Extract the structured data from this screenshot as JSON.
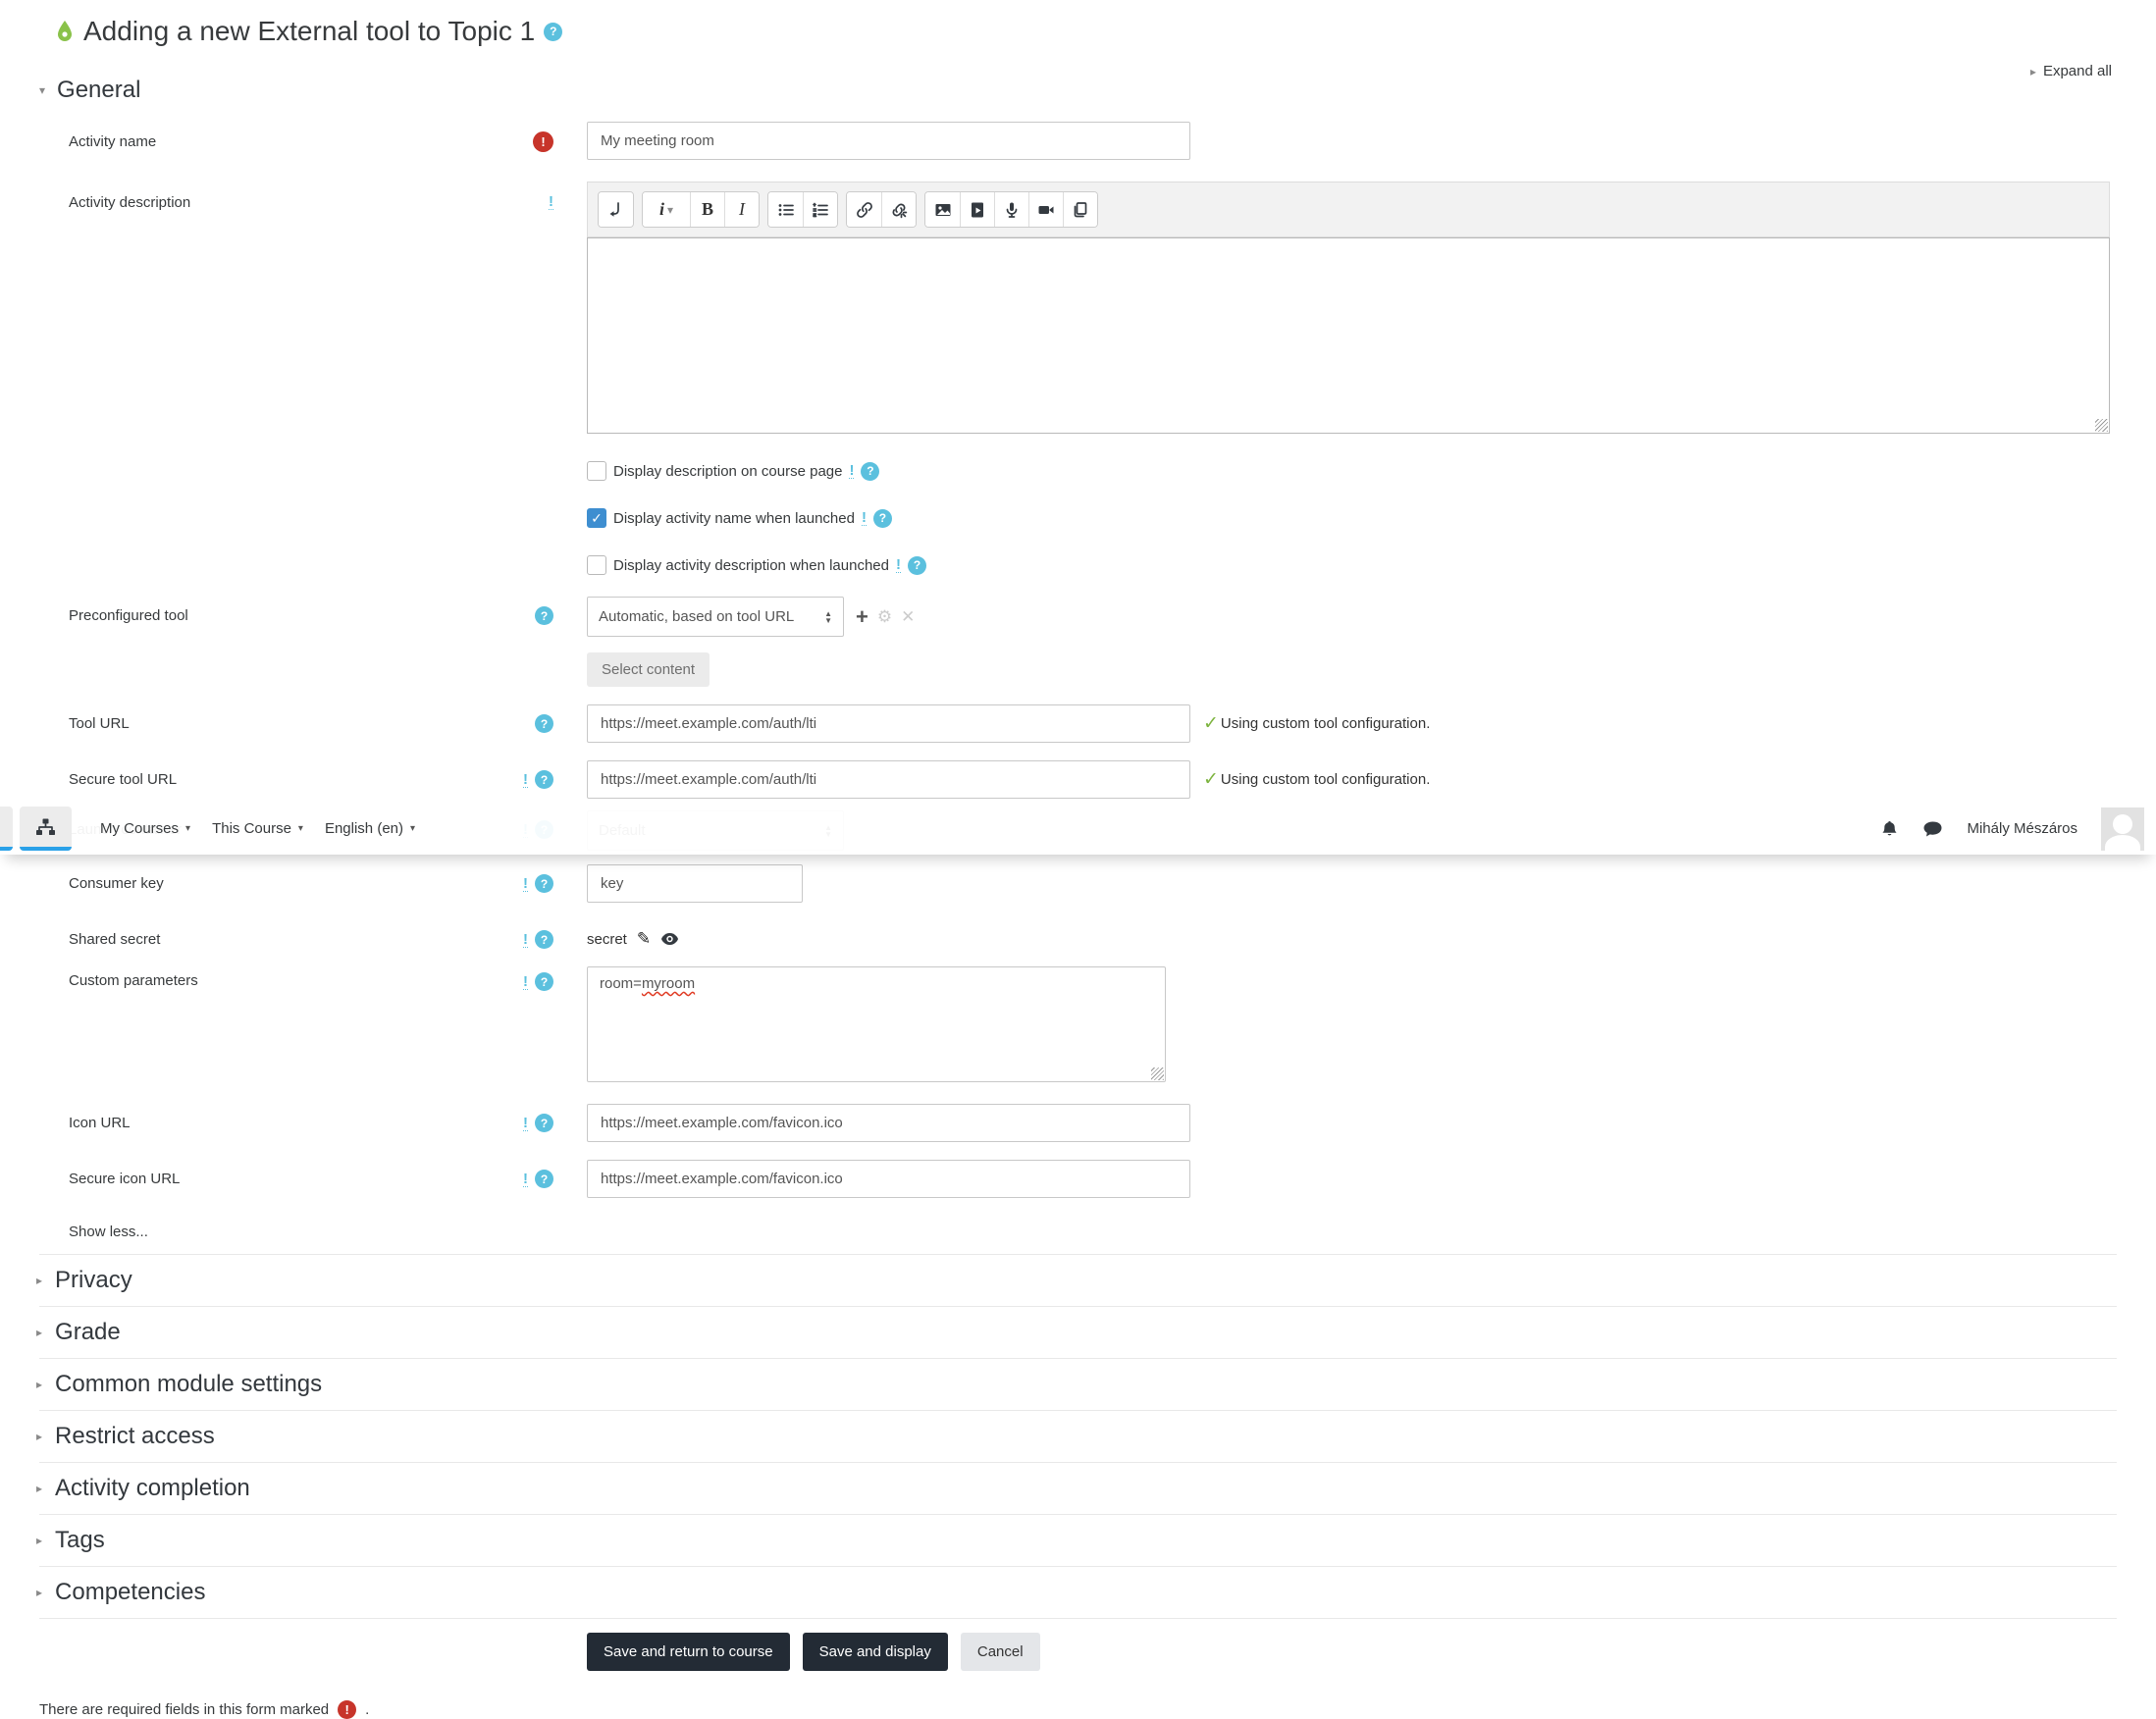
{
  "icons": {
    "help_glyph": "?",
    "required_glyph": "!",
    "advanced_glyph": "!",
    "caret_down": "▾",
    "triangle_right": "▸",
    "triangle_down": "▾",
    "check": "✓",
    "pencil": "✎",
    "plus": "+",
    "gear": "⚙",
    "close": "✕",
    "select_up": "▲",
    "select_down": "▼",
    "bold": "B",
    "italic": "I",
    "format_i": "i"
  },
  "page": {
    "title": "Adding a new External tool to Topic 1",
    "expand_all": "Expand all",
    "footer_note": "There are required fields in this form marked",
    "footer_period": "."
  },
  "navbar": {
    "links": [
      "My Courses",
      "This Course",
      "English (en)"
    ],
    "user_name": "Mihály Mészáros"
  },
  "form": {
    "general_heading": "General",
    "activity_name": {
      "label": "Activity name",
      "value": "My meeting room"
    },
    "activity_description": {
      "label": "Activity description"
    },
    "checkboxes": [
      {
        "label": "Display description on course page",
        "checked": false
      },
      {
        "label": "Display activity name when launched",
        "checked": true
      },
      {
        "label": "Display activity description when launched",
        "checked": false
      }
    ],
    "preconfigured_tool": {
      "label": "Preconfigured tool",
      "value": "Automatic, based on tool URL",
      "select_content_label": "Select content"
    },
    "tool_url": {
      "label": "Tool URL",
      "value": "https://meet.example.com/auth/lti",
      "status": "Using custom tool configuration."
    },
    "secure_tool_url": {
      "label": "Secure tool URL",
      "value": "https://meet.example.com/auth/lti",
      "status": "Using custom tool configuration."
    },
    "launch_container": {
      "label": "Launch container",
      "value": "Default"
    },
    "consumer_key": {
      "label": "Consumer key",
      "value": "key"
    },
    "shared_secret": {
      "label": "Shared secret",
      "value": "secret"
    },
    "custom_parameters": {
      "label": "Custom parameters",
      "value_prefix": "room=",
      "value_word": "myroom"
    },
    "icon_url": {
      "label": "Icon URL",
      "value": "https://meet.example.com/favicon.ico"
    },
    "secure_icon_url": {
      "label": "Secure icon URL",
      "value": "https://meet.example.com/favicon.ico"
    },
    "show_less": "Show less...",
    "sections": [
      "Privacy",
      "Grade",
      "Common module settings",
      "Restrict access",
      "Activity completion",
      "Tags",
      "Competencies"
    ],
    "buttons": {
      "save_return": "Save and return to course",
      "save_display": "Save and display",
      "cancel": "Cancel"
    }
  },
  "colors": {
    "accent_blue": "#5bc0de",
    "required_red": "#c7342a",
    "checkbox_blue": "#3e8ed0",
    "green_check": "#7db43f",
    "tab_underline": "#2aa1e8",
    "button_dark": "#232b35"
  }
}
